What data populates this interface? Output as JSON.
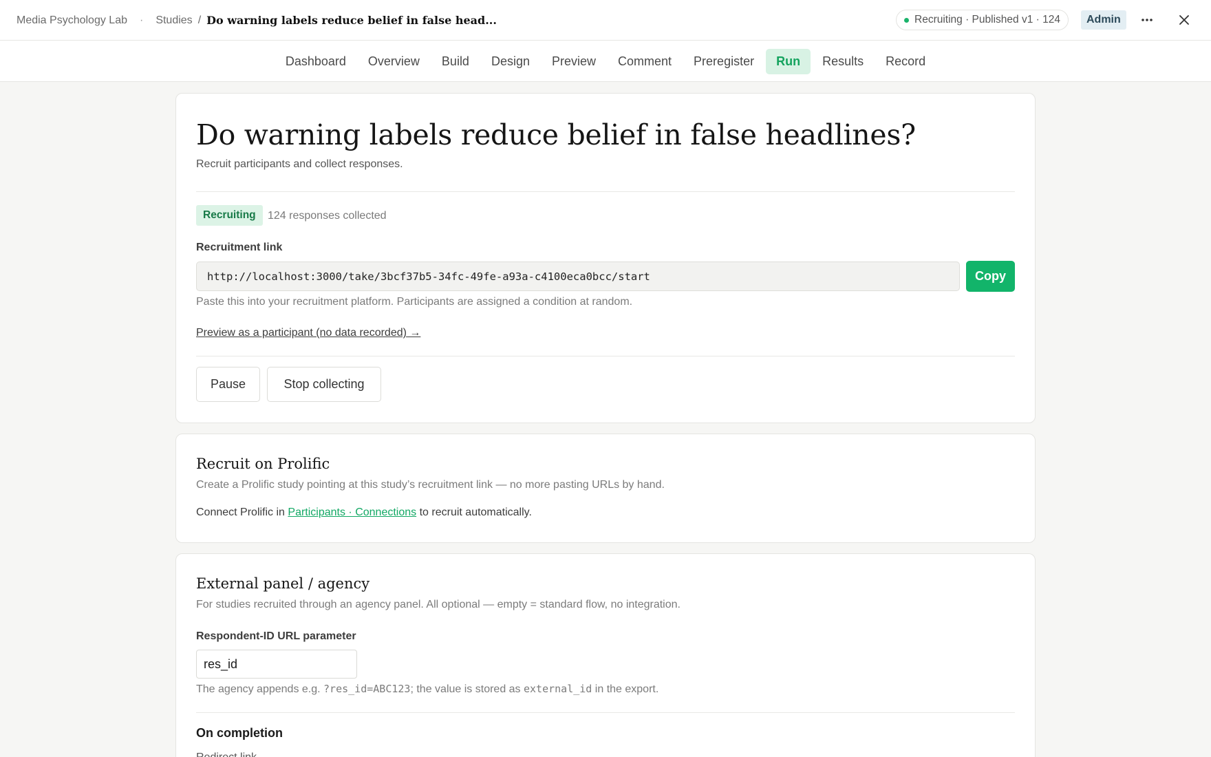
{
  "header": {
    "org": "Media Psychology Lab",
    "dot": "·",
    "studies": "Studies",
    "sep": "/",
    "current": "Do warning labels reduce belief in false head...",
    "status_pill": "Recruiting · Published v1 · 124",
    "admin": "Admin",
    "more_icon": "more-horizontal-icon",
    "close_icon": "close-icon"
  },
  "tabs": [
    {
      "label": "Dashboard"
    },
    {
      "label": "Overview"
    },
    {
      "label": "Build"
    },
    {
      "label": "Design"
    },
    {
      "label": "Preview"
    },
    {
      "label": "Comment"
    },
    {
      "label": "Preregister"
    },
    {
      "label": "Run",
      "active": true
    },
    {
      "label": "Results"
    },
    {
      "label": "Record"
    }
  ],
  "run": {
    "title": "Do warning labels reduce belief in false headlines?",
    "subtitle": "Recruit participants and collect responses.",
    "status_badge": "Recruiting",
    "responses": "124 responses collected",
    "link_label": "Recruitment link",
    "link_value": "http://localhost:3000/take/3bcf37b5-34fc-49fe-a93a-c4100eca0bcc/start",
    "copy_label": "Copy",
    "link_help": "Paste this into your recruitment platform. Participants are assigned a condition at random.",
    "preview_link": "Preview as a participant (no data recorded) →",
    "pause_label": "Pause",
    "stop_label": "Stop collecting"
  },
  "prolific": {
    "title": "Recruit on Prolific",
    "desc": "Create a Prolific study pointing at this study’s recruitment link — no more pasting URLs by hand.",
    "connect_prefix": "Connect Prolific in ",
    "connect_link": "Participants · Connections",
    "connect_suffix": " to recruit automatically."
  },
  "external": {
    "title": "External panel / agency",
    "desc": "For studies recruited through an agency panel. All optional — empty = standard flow, no integration.",
    "param_label": "Respondent-ID URL parameter",
    "param_value": "res_id",
    "help_prefix": "The agency appends e.g. ",
    "help_code1": "?res_id=ABC123",
    "help_middle": "; the value is stored as ",
    "help_code2": "external_id",
    "help_suffix": " in the export.",
    "completion_heading": "On completion",
    "redirect_label": "Redirect link"
  },
  "colors": {
    "accent": "#12b46a",
    "status_dot": "#1ab36b"
  }
}
